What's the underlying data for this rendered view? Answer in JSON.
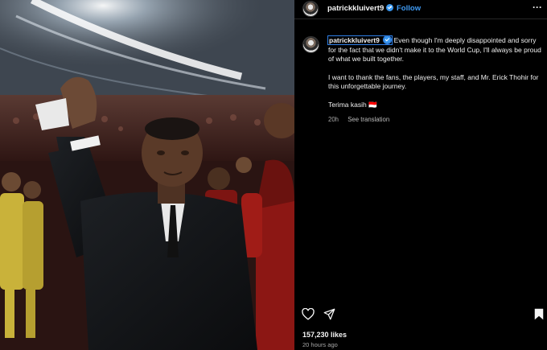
{
  "post": {
    "username": "patrickkluivert9",
    "follow_label": "Follow",
    "separator": "•",
    "more_label": "···",
    "caption": {
      "username": "patrickkluivert9",
      "paragraph1": "Even though I'm deeply disappointed and sorry for the fact that we didn't make it to the World Cup, I'll always be proud of what we built together.",
      "paragraph2": "I want to thank the fans, the players, my staff, and Mr. Erick Thohir for this unforgettable journey.",
      "paragraph3": "Terima kasih 🇮🇩",
      "age": "20h",
      "see_translation": "See translation"
    },
    "likes": "157,230 likes",
    "timestamp": "20 hours ago"
  },
  "icons": {
    "verified": "verified-badge-icon",
    "heart": "heart-icon",
    "share": "share-icon",
    "bookmark": "bookmark-icon",
    "more": "more-options-icon"
  },
  "colors": {
    "background": "#000000",
    "follow": "#3f9bf4",
    "verified": "#3897f0",
    "highlight_outline": "#2f7fe6",
    "muted_text": "#a8a8a8"
  }
}
